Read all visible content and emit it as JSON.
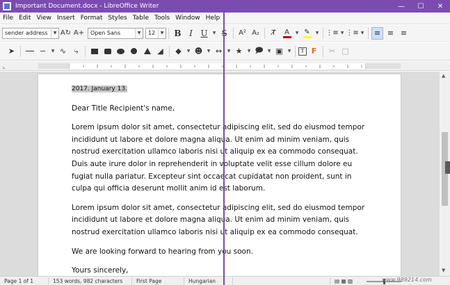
{
  "window": {
    "title": "Important Document.docx - LibreOffice Writer",
    "controls": [
      "minimize",
      "maximize",
      "close"
    ]
  },
  "menu": [
    "File",
    "Edit",
    "View",
    "Insert",
    "Format",
    "Styles",
    "Table",
    "Tools",
    "Window",
    "Help"
  ],
  "toolbar": {
    "paragraph_style": "sender address",
    "font_name": "Open Sans",
    "font_size": "12"
  },
  "document": {
    "date": "2017. January 13.",
    "greeting": "Dear Title Recipient's name,",
    "paragraph1": "Lorem ipsum dolor sit amet, consectetur adipiscing elit, sed do eiusmod tempor incididunt ut labore et dolore magna aliqua. Ut enim ad minim veniam, quis nostrud exercitation ullamco laboris nisi ut aliquip ex ea commodo consequat. Duis aute irure dolor in reprehenderit in voluptate velit esse cillum dolore eu fugiat nulla pariatur. Excepteur sint occaecat cupidatat non proident, sunt in culpa qui officia deserunt mollit anim id est laborum.",
    "paragraph2": "Lorem ipsum dolor sit amet, consectetur adipiscing elit, sed do eiusmod tempor incididunt ut labore et dolore magna aliqua. Ut enim ad minim veniam, quis nostrud exercitation ullamco laboris nisi ut aliquip ex ea commodo consequat.",
    "closing_line": "We are looking forward to hearing from you soon.",
    "sign_off": "Yours sincerely,"
  },
  "statusbar": {
    "page": "Page 1 of 1",
    "words": "153 words, 982 characters",
    "page_style": "First Page",
    "language": "Hungarian"
  },
  "watermark": "www.989214.com",
  "colors": {
    "titlebar": "#7B4CB0",
    "font_color_bar": "#C00000",
    "highlight_bar": "#FFFF00"
  },
  "icons": {
    "bold": "B",
    "italic": "I",
    "underline": "U",
    "strikethrough": "S"
  }
}
